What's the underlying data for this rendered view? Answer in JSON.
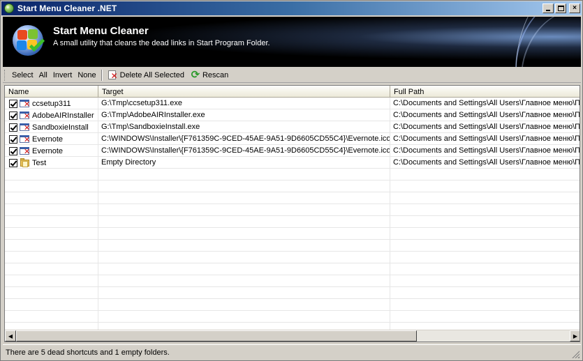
{
  "window": {
    "title": "Start Menu Cleaner .NET",
    "icon": "app-globe-icon",
    "controls": {
      "minimize": "minimize-icon",
      "maximize": "maximize-icon",
      "close": "×"
    }
  },
  "banner": {
    "title": "Start Menu Cleaner",
    "subtitle": "A small utility that cleans the dead links in Start Program Folder.",
    "logo": "windows-logo-check-icon"
  },
  "toolbar": {
    "select": "Select",
    "all": "All",
    "invert": "Invert",
    "none": "None",
    "delete_all_selected": "Delete All Selected",
    "rescan": "Rescan"
  },
  "list": {
    "columns": [
      "Name",
      "Target",
      "Full Path"
    ],
    "rows": [
      {
        "checked": true,
        "icon": "dead-shortcut-icon",
        "name": "ccsetup311",
        "target": "G:\\Tmp\\ccsetup311.exe",
        "full_path": "C:\\Documents and Settings\\All Users\\Главное меню\\Пр"
      },
      {
        "checked": true,
        "icon": "dead-shortcut-icon",
        "name": "AdobeAIRInstaller",
        "target": "G:\\Tmp\\AdobeAIRInstaller.exe",
        "full_path": "C:\\Documents and Settings\\All Users\\Главное меню\\Пр"
      },
      {
        "checked": true,
        "icon": "dead-shortcut-icon",
        "name": "SandboxieInstall",
        "target": "G:\\Tmp\\SandboxieInstall.exe",
        "full_path": "C:\\Documents and Settings\\All Users\\Главное меню\\Пр"
      },
      {
        "checked": true,
        "icon": "dead-shortcut-icon",
        "name": "Evernote",
        "target": "C:\\WINDOWS\\Installer\\{F761359C-9CED-45AE-9A51-9D6605CD55C4}\\Evernote.ico",
        "full_path": "C:\\Documents and Settings\\All Users\\Главное меню\\Пр"
      },
      {
        "checked": true,
        "icon": "dead-shortcut-icon",
        "name": "Evernote",
        "target": "C:\\WINDOWS\\Installer\\{F761359C-9CED-45AE-9A51-9D6605CD55C4}\\Evernote.ico",
        "full_path": "C:\\Documents and Settings\\All Users\\Главное меню\\Пр"
      },
      {
        "checked": true,
        "icon": "empty-folder-icon",
        "name": "Test",
        "target": "Empty Directory",
        "full_path": "C:\\Documents and Settings\\All Users\\Главное меню\\Пр"
      }
    ]
  },
  "status": {
    "text": "There are 5 dead shortcuts and 1 empty folders."
  }
}
